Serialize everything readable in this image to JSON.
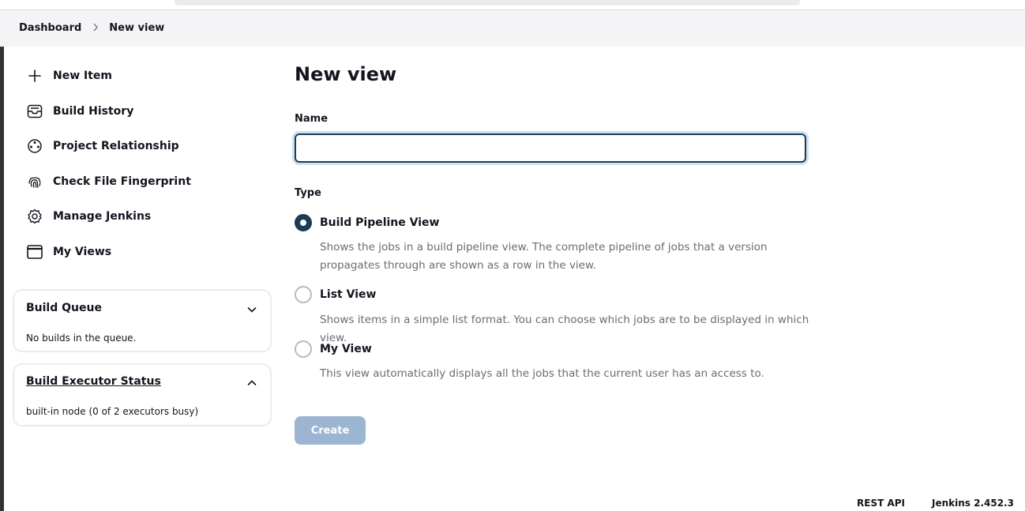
{
  "breadcrumb": {
    "home": "Dashboard",
    "current": "New view"
  },
  "sidebar": {
    "items": [
      {
        "label": "New Item",
        "icon": "plus-icon"
      },
      {
        "label": "Build History",
        "icon": "inbox-icon"
      },
      {
        "label": "Project Relationship",
        "icon": "relationship-icon"
      },
      {
        "label": "Check File Fingerprint",
        "icon": "fingerprint-icon"
      },
      {
        "label": "Manage Jenkins",
        "icon": "gear-icon"
      },
      {
        "label": "My Views",
        "icon": "window-icon"
      }
    ]
  },
  "build_queue": {
    "title": "Build Queue",
    "text": "No builds in the queue.",
    "state": "collapsed"
  },
  "executor_status": {
    "title": "Build Executor Status",
    "text": "built-in node (0 of 2 executors busy)",
    "state": "expanded"
  },
  "main": {
    "title": "New view",
    "name_label": "Name",
    "name_value": "",
    "type_label": "Type",
    "types": [
      {
        "label": "Build Pipeline View",
        "selected": true,
        "desc": "Shows the jobs in a build pipeline view. The complete pipeline of jobs that a version propagates through are shown as a row in the view."
      },
      {
        "label": "List View",
        "selected": false,
        "desc": "Shows items in a simple list format. You can choose which jobs are to be displayed in which view."
      },
      {
        "label": "My View",
        "selected": false,
        "desc": "This view automatically displays all the jobs that the current user has an access to."
      }
    ],
    "create_label": "Create"
  },
  "footer": {
    "rest_api": "REST API",
    "version": "Jenkins 2.452.3"
  },
  "colors": {
    "accent": "#1d3b53",
    "button_disabled": "#9bb5d2",
    "muted_text": "#6b6b75"
  }
}
